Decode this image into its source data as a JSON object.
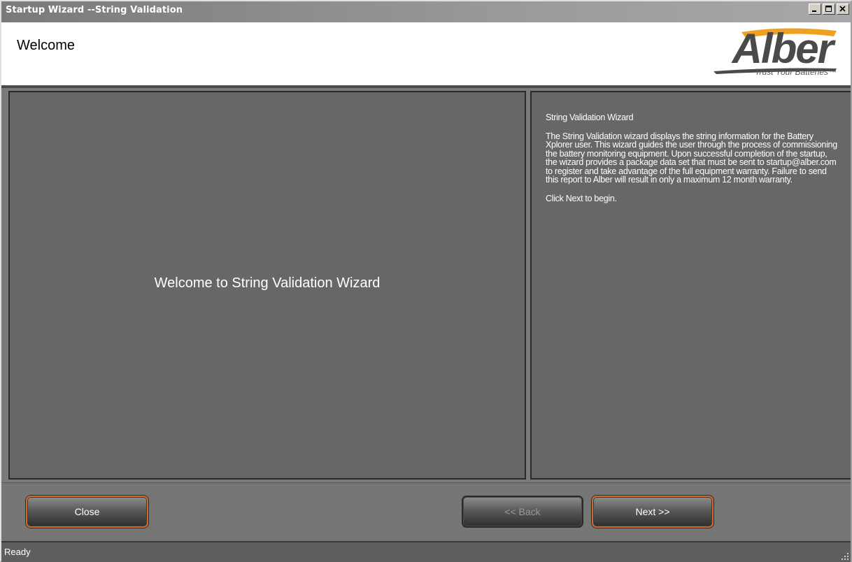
{
  "window": {
    "title": "Startup Wizard --String Validation",
    "controls": {
      "minimize_icon": "minimize-icon",
      "maximize_icon": "maximize-icon",
      "close_icon": "close-icon"
    }
  },
  "header": {
    "title": "Welcome",
    "logo": {
      "word": "Alber",
      "tagline": "Trust Your Batteries™"
    }
  },
  "main": {
    "welcome_text": "Welcome to String Validation Wizard"
  },
  "info": {
    "heading": "String Validation Wizard",
    "body": "The String Validation wizard displays the string information for the Battery Xplorer user. This wizard guides the user through the process of commissioning the battery monitoring equipment. Upon successful completion of the startup, the wizard provides a package data set that must be sent to startup@alber.com to register and take advantage of the full equipment warranty. Failure to send this report to Alber will result in only a maximum 12 month warranty.",
    "instruction": "Click Next to begin."
  },
  "buttons": {
    "close_label": "Close",
    "back_label": "<< Back",
    "next_label": "Next >>"
  },
  "status": {
    "text": "Ready"
  },
  "colors": {
    "accent_border": "#d06a2a",
    "logo_orange": "#f0a020",
    "panel_bg": "#676767"
  }
}
